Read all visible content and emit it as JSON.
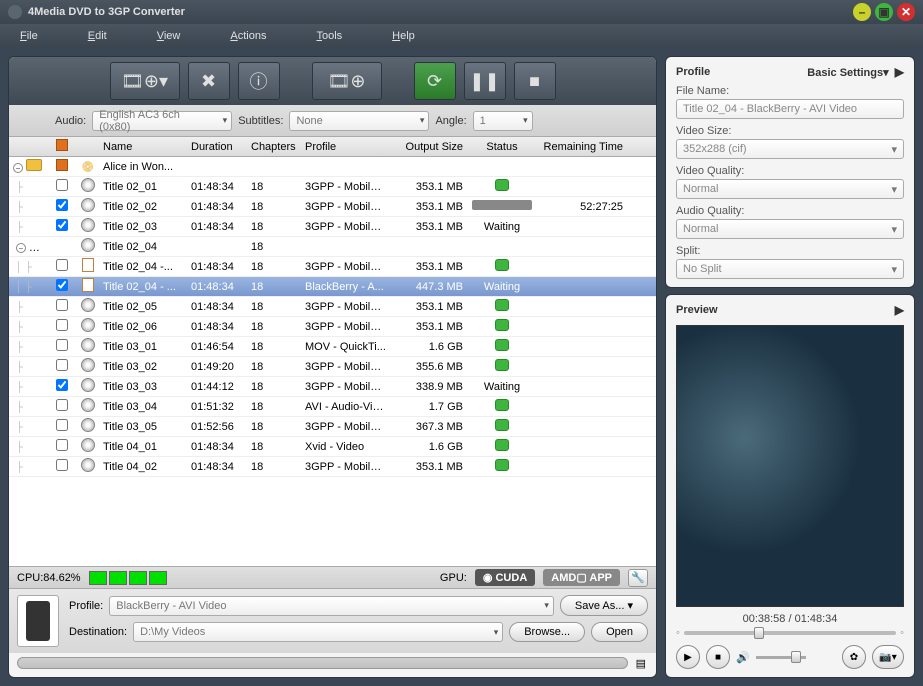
{
  "title": "4Media DVD to 3GP Converter",
  "menu": [
    "File",
    "Edit",
    "View",
    "Actions",
    "Tools",
    "Help"
  ],
  "toolbar": {
    "add_files": "add-files",
    "remove": "remove",
    "info": "info",
    "add_profile": "add-profile",
    "refresh": "refresh",
    "pause": "pause",
    "stop": "stop"
  },
  "filters": {
    "audio_label": "Audio:",
    "audio_value": "English AC3 6ch (0x80)",
    "subtitles_label": "Subtitles:",
    "subtitles_value": "None",
    "angle_label": "Angle:",
    "angle_value": "1"
  },
  "columns": [
    "Name",
    "Duration",
    "Chapters",
    "Profile",
    "Output Size",
    "Status",
    "Remaining Time"
  ],
  "rows": [
    {
      "tree": "root",
      "chk": "orange",
      "icon": "dvd",
      "name": "Alice in Won...",
      "dur": "",
      "chap": "",
      "prof": "",
      "size": "",
      "stat": "",
      "rem": ""
    },
    {
      "tree": "l1",
      "chk": "off",
      "icon": "disc",
      "name": "Title 02_01",
      "dur": "01:48:34",
      "chap": "18",
      "prof": "3GPP - Mobile ...",
      "size": "353.1 MB",
      "stat": "dot",
      "rem": ""
    },
    {
      "tree": "l1",
      "chk": "on",
      "icon": "disc",
      "name": "Title 02_02",
      "dur": "01:48:34",
      "chap": "18",
      "prof": "3GPP - Mobile ...",
      "size": "353.1 MB",
      "stat": "progress",
      "rem": "52:27:25"
    },
    {
      "tree": "l1",
      "chk": "on",
      "icon": "disc",
      "name": "Title 02_03",
      "dur": "01:48:34",
      "chap": "18",
      "prof": "3GPP - Mobile ...",
      "size": "353.1 MB",
      "stat": "Waiting",
      "rem": ""
    },
    {
      "tree": "branch",
      "chk": "",
      "icon": "disc",
      "name": "Title 02_04",
      "dur": "",
      "chap": "18",
      "prof": "",
      "size": "",
      "stat": "",
      "rem": ""
    },
    {
      "tree": "l2",
      "chk": "off",
      "icon": "doc",
      "name": "Title 02_04 -...",
      "dur": "01:48:34",
      "chap": "18",
      "prof": "3GPP - Mobile ...",
      "size": "353.1 MB",
      "stat": "dot",
      "rem": ""
    },
    {
      "tree": "l2",
      "chk": "on",
      "icon": "doc",
      "name": "Title 02_04 - ...",
      "dur": "01:48:34",
      "chap": "18",
      "prof": "BlackBerry - A...",
      "size": "447.3 MB",
      "stat": "Waiting",
      "rem": "",
      "sel": true
    },
    {
      "tree": "l1",
      "chk": "off",
      "icon": "disc",
      "name": "Title 02_05",
      "dur": "01:48:34",
      "chap": "18",
      "prof": "3GPP - Mobile ...",
      "size": "353.1 MB",
      "stat": "dot",
      "rem": ""
    },
    {
      "tree": "l1",
      "chk": "off",
      "icon": "disc",
      "name": "Title 02_06",
      "dur": "01:48:34",
      "chap": "18",
      "prof": "3GPP - Mobile ...",
      "size": "353.1 MB",
      "stat": "dot",
      "rem": ""
    },
    {
      "tree": "l1",
      "chk": "off",
      "icon": "disc",
      "name": "Title 03_01",
      "dur": "01:46:54",
      "chap": "18",
      "prof": "MOV - QuickTi...",
      "size": "1.6 GB",
      "stat": "dot",
      "rem": ""
    },
    {
      "tree": "l1",
      "chk": "off",
      "icon": "disc",
      "name": "Title 03_02",
      "dur": "01:49:20",
      "chap": "18",
      "prof": "3GPP - Mobile ...",
      "size": "355.6 MB",
      "stat": "dot",
      "rem": ""
    },
    {
      "tree": "l1",
      "chk": "on",
      "icon": "disc",
      "name": "Title 03_03",
      "dur": "01:44:12",
      "chap": "18",
      "prof": "3GPP - Mobile ...",
      "size": "338.9 MB",
      "stat": "Waiting",
      "rem": ""
    },
    {
      "tree": "l1",
      "chk": "off",
      "icon": "disc",
      "name": "Title 03_04",
      "dur": "01:51:32",
      "chap": "18",
      "prof": "AVI - Audio-Vid...",
      "size": "1.7 GB",
      "stat": "dot",
      "rem": ""
    },
    {
      "tree": "l1",
      "chk": "off",
      "icon": "disc",
      "name": "Title 03_05",
      "dur": "01:52:56",
      "chap": "18",
      "prof": "3GPP - Mobile ...",
      "size": "367.3 MB",
      "stat": "dot",
      "rem": ""
    },
    {
      "tree": "l1",
      "chk": "off",
      "icon": "disc",
      "name": "Title 04_01",
      "dur": "01:48:34",
      "chap": "18",
      "prof": "Xvid - Video",
      "size": "1.6 GB",
      "stat": "dot",
      "rem": ""
    },
    {
      "tree": "l1",
      "chk": "off",
      "icon": "disc",
      "name": "Title 04_02",
      "dur": "01:48:34",
      "chap": "18",
      "prof": "3GPP - Mobile ...",
      "size": "353.1 MB",
      "stat": "dot",
      "rem": ""
    }
  ],
  "cpu": {
    "label": "CPU:84.62%",
    "gpu_label": "GPU:",
    "cuda": "CUDA",
    "amd": "AMD",
    "app": "APP"
  },
  "bottom": {
    "profile_label": "Profile:",
    "profile_value": "BlackBerry - AVI Video",
    "saveas": "Save As...",
    "dest_label": "Destination:",
    "dest_value": "D:\\My Videos",
    "browse": "Browse...",
    "open": "Open"
  },
  "profile": {
    "header": "Profile",
    "basic": "Basic Settings",
    "filename_label": "File Name:",
    "filename_value": "Title 02_04 - BlackBerry - AVI Video",
    "videosize_label": "Video Size:",
    "videosize_value": "352x288 (cif)",
    "vquality_label": "Video Quality:",
    "vquality_value": "Normal",
    "aquality_label": "Audio Quality:",
    "aquality_value": "Normal",
    "split_label": "Split:",
    "split_value": "No Split"
  },
  "preview": {
    "header": "Preview",
    "time": "00:38:58 / 01:48:34"
  }
}
